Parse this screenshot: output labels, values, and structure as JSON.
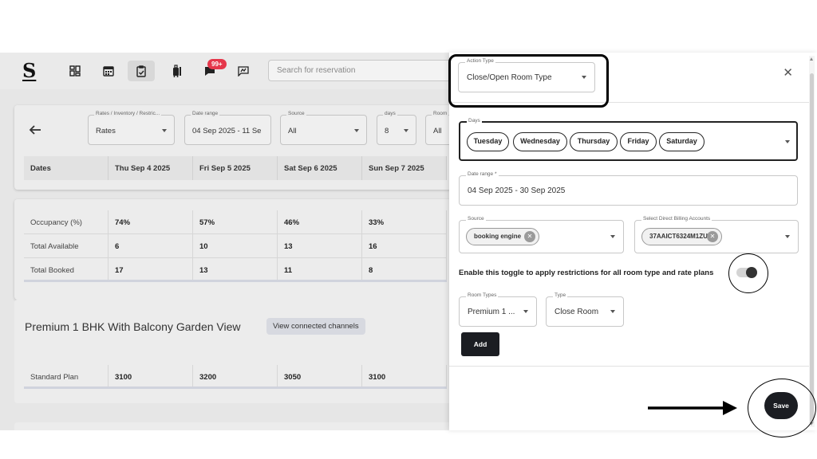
{
  "header": {
    "logo": "S",
    "notification_badge": "99+",
    "search_placeholder": "Search for reservation"
  },
  "filters": {
    "view": {
      "label": "Rates / Inventory / Restric...",
      "value": "Rates"
    },
    "date_range": {
      "label": "Date range",
      "value": "04 Sep 2025 - 11 Se"
    },
    "source": {
      "label": "Source",
      "value": "All"
    },
    "days": {
      "label": "days",
      "value": "8"
    },
    "room": {
      "label": "Room",
      "value": "All"
    }
  },
  "dates": [
    "Dates",
    "Thu Sep 4 2025",
    "Fri Sep 5 2025",
    "Sat Sep 6 2025",
    "Sun Sep 7 2025"
  ],
  "stats": [
    [
      "Occupancy (%)",
      "74%",
      "57%",
      "46%",
      "33%"
    ],
    [
      "Total Available",
      "6",
      "10",
      "13",
      "16"
    ],
    [
      "Total Booked",
      "17",
      "13",
      "11",
      "8"
    ]
  ],
  "room": {
    "title": "Premium 1 BHK With Balcony Garden View",
    "channels_button": "View connected channels",
    "plan_row": [
      "Standard Plan",
      "3100",
      "3200",
      "3050",
      "3100"
    ]
  },
  "panel": {
    "action_type": {
      "label": "Action Type",
      "value": "Close/Open Room Type"
    },
    "days": {
      "label": "Days",
      "chips": [
        "Tuesday",
        "Wednesday",
        "Thursday",
        "Friday",
        "Saturday"
      ]
    },
    "date_range": {
      "label": "Date range *",
      "value": "04 Sep 2025 - 30 Sep 2025"
    },
    "source": {
      "label": "Source",
      "chip": "booking engine"
    },
    "billing": {
      "label": "Select Direct Billing Accounts",
      "chip": "37AAICT6324M1ZU"
    },
    "toggle_label": "Enable this toggle to apply restrictions for all room type and rate plans",
    "toggle_on": false,
    "room_types": {
      "label": "Room Types",
      "value": "Premium 1 ..."
    },
    "type": {
      "label": "Type",
      "value": "Close Room"
    },
    "add_button": "Add",
    "save_button": "Save"
  }
}
